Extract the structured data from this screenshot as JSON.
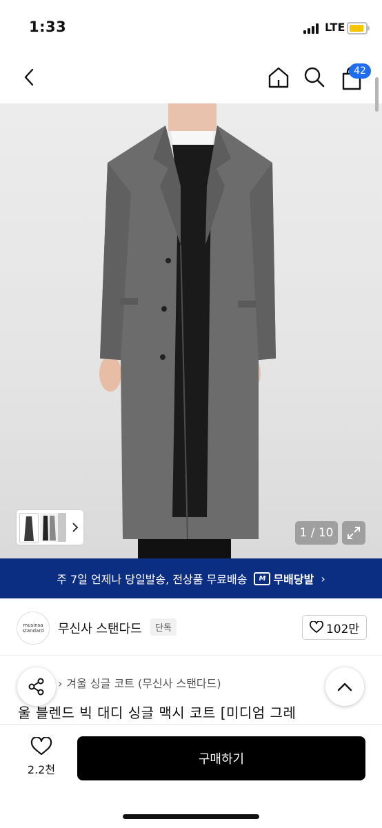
{
  "status": {
    "time": "1:33",
    "network": "LTE"
  },
  "nav": {
    "cart_count": "42"
  },
  "gallery": {
    "counter": "1 / 10"
  },
  "promo": {
    "text": "주 7일 언제나 당일발송, 전상품 무료배송",
    "badge": "무배당발"
  },
  "brand": {
    "logo_line1": "musinsa",
    "logo_line2": "standard",
    "name": "무신사 스탠다드",
    "tag": "단독",
    "likes": "102만"
  },
  "breadcrumb": {
    "category": "겨울 싱글 코트 (무신사 스탠다드)"
  },
  "product": {
    "title": "울 블렌드 빅 대디 싱글 맥시 코트 [미디엄 그레"
  },
  "bottom": {
    "wish_count": "2.2천",
    "buy_label": "구매하기"
  },
  "colors": {
    "accent": "#1e6cf0",
    "promo_bg": "#0b2d82",
    "buy_bg": "#000000"
  }
}
